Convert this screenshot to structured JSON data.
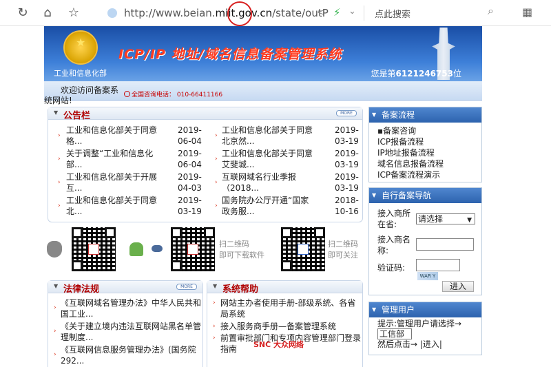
{
  "browser": {
    "url_prefix": "http://www.beian.",
    "url_domain": "miit.gov.cn",
    "url_suffix": "/state/outP",
    "search_placeholder": "点此搜索"
  },
  "banner": {
    "ministry": "工业和信息化部",
    "title": "ICP/IP 地址/域名信息备案管理系统",
    "visitor_prefix": "您是第",
    "visitor_count": "6121246753",
    "visitor_suffix": "位"
  },
  "welcome": {
    "line1": "欢迎访问备案系",
    "line2": "统网站!",
    "phone": "全国咨询电话： 010-66411166"
  },
  "announcement": {
    "title": "公告栏",
    "more": "MORE",
    "left": [
      {
        "l1": "工业和信息化部关于同意",
        "l2": "格...",
        "d1": "2019-",
        "d2": "06-04"
      },
      {
        "l1": "关于调整“工业和信息化",
        "l2": "部...",
        "d1": "2019-",
        "d2": "06-04"
      },
      {
        "l1": "工业和信息化部关于开展",
        "l2": "互...",
        "d1": "2019-",
        "d2": "04-03"
      },
      {
        "l1": "工业和信息化部关于同意",
        "l2": "北...",
        "d1": "2019-",
        "d2": "03-19"
      }
    ],
    "right": [
      {
        "l1": "工业和信息化部关于同意",
        "l2": "北京然...",
        "d1": "2019-",
        "d2": "03-19"
      },
      {
        "l1": "工业和信息化部关于同意",
        "l2": "艾斐城...",
        "d1": "2019-",
        "d2": "03-19"
      },
      {
        "l1": "互联网域名行业季报",
        "l2": "（2018...",
        "d1": "2019-",
        "d2": "03-19"
      },
      {
        "l1": "国务院办公厅开通“国家",
        "l2": "政务服...",
        "d1": "2018-",
        "d2": "10-16"
      }
    ]
  },
  "qr": {
    "download_l1": "扫二维码",
    "download_l2": "即可下载软件",
    "follow_l1": "扫二维码",
    "follow_l2": "即可关注"
  },
  "law": {
    "title": "法律法规",
    "more": "MORE",
    "items": [
      {
        "l1": "《互联网域名管理办法》中华人民共和",
        "l2": "国工业..."
      },
      {
        "l1": "《关于建立境内违法互联网站黑名单管",
        "l2": "理制度..."
      },
      {
        "l1": "《互联网信息服务管理办法》(国务院",
        "l2": "292..."
      }
    ]
  },
  "help": {
    "title": "系统帮助",
    "items": [
      {
        "l1": "网站主办者使用手册-部级系统、各省",
        "l2": "局系统"
      },
      {
        "l1": "接入服务商手册—备案管理系统",
        "l2": ""
      },
      {
        "l1": "前置审批部门和专项内容管理部门登录",
        "l2": "指南"
      }
    ]
  },
  "flow": {
    "title": "备案流程",
    "items": [
      "备案咨询",
      "ICP报备流程",
      "IP地址报备流程",
      "域名信息报备流程",
      "ICP备案流程演示"
    ]
  },
  "nav": {
    "title": "自行备案导航",
    "province_label_l1": "接入商所",
    "province_label_l2": "在省:",
    "province_value": "请选择",
    "name_label_l1": "接入商名",
    "name_label_l2": "称:",
    "code_label": "验证码:",
    "captcha_text": "WAR Y",
    "enter_button": "进入"
  },
  "admin": {
    "title": "管理用户",
    "hint": "提示:管理用户请选择→",
    "choice": "工信部",
    "then_prefix": "然后点击→",
    "enter_link": "|进入|"
  },
  "watermark": "SNC 大众网络"
}
